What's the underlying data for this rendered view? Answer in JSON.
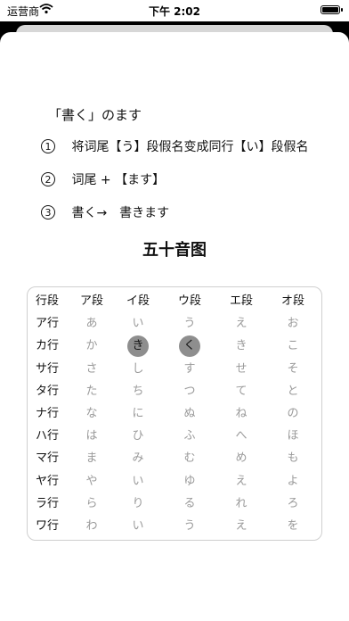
{
  "status": {
    "carrier": "运营商",
    "time": "下午 2:02"
  },
  "lesson": {
    "title": "「書く」のます",
    "steps": [
      {
        "num": "1",
        "text": "将词尾【う】段假名变成同行【い】段假名"
      },
      {
        "num": "2",
        "text": "词尾 + 【ます】"
      },
      {
        "num": "3",
        "text": "書く→　書きます"
      }
    ]
  },
  "table": {
    "title": "五十音图",
    "headers": [
      "行段",
      "ア段",
      "イ段",
      "ウ段",
      "エ段",
      "オ段"
    ],
    "rows": [
      {
        "label": "ア行",
        "cells": [
          "あ",
          "い",
          "う",
          "え",
          "お"
        ]
      },
      {
        "label": "カ行",
        "cells": [
          "か",
          "き",
          "く",
          "き",
          "こ"
        ]
      },
      {
        "label": "サ行",
        "cells": [
          "さ",
          "し",
          "す",
          "せ",
          "そ"
        ]
      },
      {
        "label": "タ行",
        "cells": [
          "た",
          "ち",
          "つ",
          "て",
          "と"
        ]
      },
      {
        "label": "ナ行",
        "cells": [
          "な",
          "に",
          "ぬ",
          "ね",
          "の"
        ]
      },
      {
        "label": "ハ行",
        "cells": [
          "は",
          "ひ",
          "ふ",
          "へ",
          "ほ"
        ]
      },
      {
        "label": "マ行",
        "cells": [
          "ま",
          "み",
          "む",
          "め",
          "も"
        ]
      },
      {
        "label": "ヤ行",
        "cells": [
          "や",
          "い",
          "ゆ",
          "え",
          "よ"
        ]
      },
      {
        "label": "ラ行",
        "cells": [
          "ら",
          "り",
          "る",
          "れ",
          "ろ"
        ]
      },
      {
        "label": "ワ行",
        "cells": [
          "わ",
          "い",
          "う",
          "え",
          "を"
        ]
      }
    ],
    "highlighted": [
      "1-1",
      "1-2"
    ]
  }
}
